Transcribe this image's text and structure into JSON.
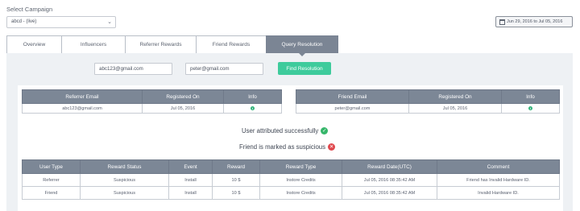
{
  "campaign": {
    "label": "Select Campaign",
    "selected": "abcd - (live)"
  },
  "date_range": "Jun 29, 2016 to Jul 05, 2016",
  "tabs": [
    {
      "label": "Overview"
    },
    {
      "label": "Influencers"
    },
    {
      "label": "Referrer Rewards"
    },
    {
      "label": "Friend Rewards"
    },
    {
      "label": "Query Resolution",
      "active": true
    }
  ],
  "query": {
    "referrer_email": "abc123@gmail.com",
    "friend_email": "peter@gmail.com",
    "find_button": "Find Resolution"
  },
  "referrer_table": {
    "headers": [
      "Referrer Email",
      "Registered On",
      "Info"
    ],
    "row": {
      "email": "abc123@gmail.com",
      "registered_on": "Jul 05, 2016",
      "info": "i"
    }
  },
  "friend_table": {
    "headers": [
      "Friend Email",
      "Registered On",
      "Info"
    ],
    "row": {
      "email": "peter@gmail.com",
      "registered_on": "Jul 05, 2016",
      "info": "i"
    }
  },
  "status": {
    "attributed": "User attributed successfully",
    "suspicious": "Friend is marked as suspicious"
  },
  "rewards_table": {
    "headers": [
      "User Type",
      "Reward Status",
      "Event",
      "Reward",
      "Reward Type",
      "Reward Date(UTC)",
      "Comment"
    ],
    "rows": [
      [
        "Referrer",
        "Suspicious",
        "Install",
        "10 $",
        "Instore Credits",
        "Jul 05, 2016 08:35:42 AM",
        "Friend has Invalid Hardware ID."
      ],
      [
        "Friend",
        "Suspicious",
        "Install",
        "10 $",
        "Instore Credits",
        "Jul 05, 2016 08:35:42 AM",
        "Invalid Hardware ID."
      ]
    ]
  },
  "colors": {
    "accent_green": "#3ecb9c",
    "header_gray": "#7c8796",
    "success": "#36b66a",
    "danger": "#e0474c"
  }
}
